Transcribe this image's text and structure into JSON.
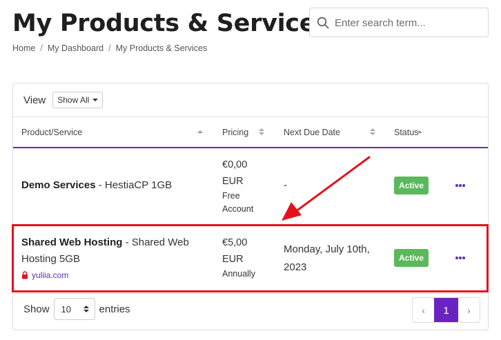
{
  "header": {
    "title": "My Products & Services",
    "search_placeholder": "Enter search term..."
  },
  "breadcrumb": [
    {
      "label": "Home"
    },
    {
      "label": "My Dashboard"
    },
    {
      "label": "My Products & Services"
    }
  ],
  "table": {
    "view_label": "View",
    "view_select": "Show All",
    "columns": {
      "product": "Product/Service",
      "pricing": "Pricing",
      "due": "Next Due Date",
      "status": "Status"
    },
    "rows": [
      {
        "name": "Demo Services",
        "suffix": " - HestiaCP 1GB",
        "price": "€0,00",
        "currency": "EUR",
        "cycle": "Free Account",
        "due": "-",
        "status": "Active",
        "domain": ""
      },
      {
        "name": "Shared Web Hosting",
        "suffix": " - Shared Web Hosting 5GB",
        "price": "€5,00",
        "currency": "EUR",
        "cycle": "Annually",
        "due": "Monday, July 10th, 2023",
        "status": "Active",
        "domain": "yuliia.com"
      }
    ]
  },
  "footer": {
    "show_label": "Show",
    "entries_value": "10",
    "entries_label": "entries",
    "pagination": {
      "prev": "‹",
      "current": "1",
      "next": "›"
    }
  },
  "colors": {
    "accent": "#5b2fb8",
    "active_badge": "#5cb85c",
    "annotation": "#e3121b"
  }
}
